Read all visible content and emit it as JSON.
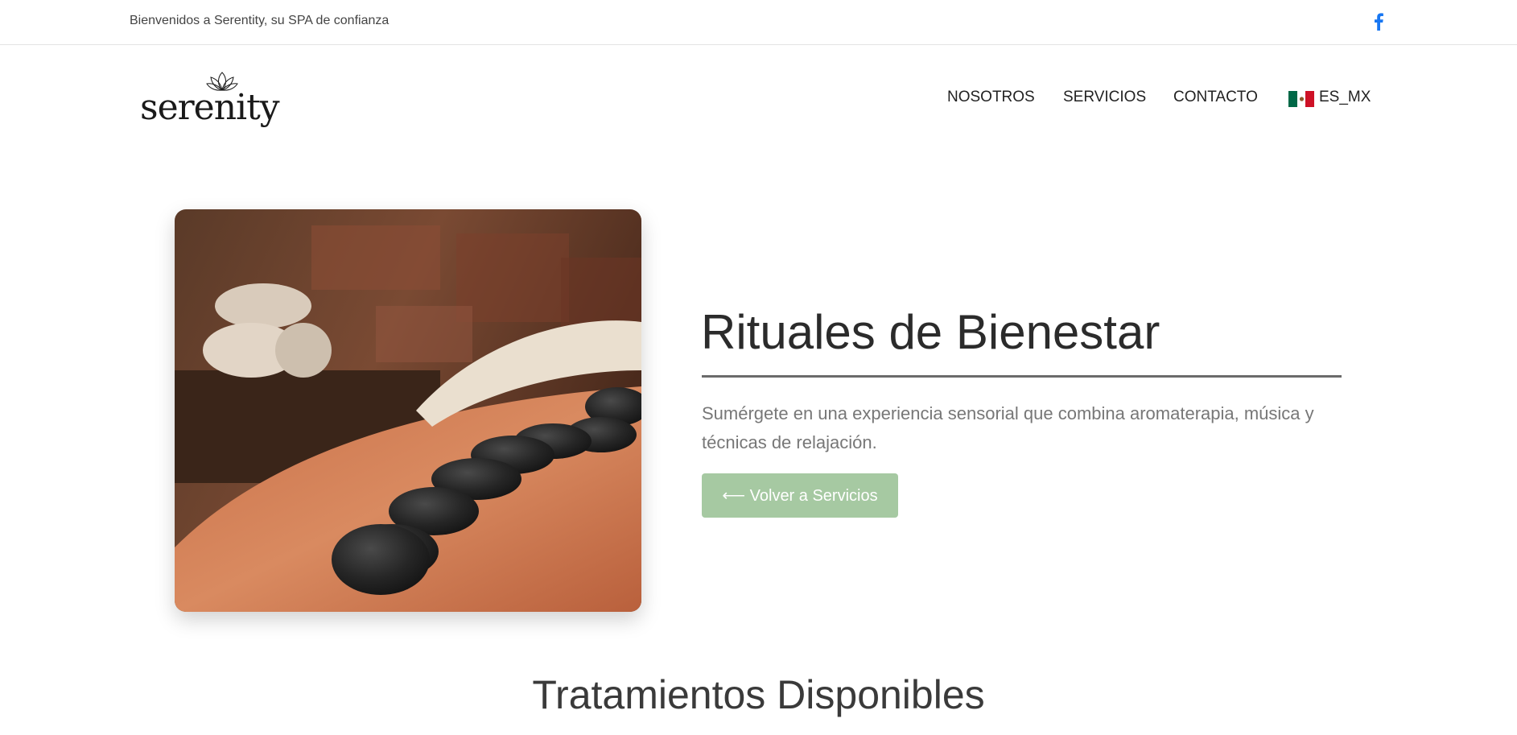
{
  "topbar": {
    "welcome_text": "Bienvenidos a Serentity, su SPA de confianza",
    "facebook_icon": "facebook-icon",
    "facebook_color": "#1877f2"
  },
  "header": {
    "logo_text": "serenity",
    "nav": [
      {
        "label": "NOSOTROS"
      },
      {
        "label": "SERVICIOS"
      },
      {
        "label": "CONTACTO"
      }
    ],
    "language": {
      "label": "ES_MX",
      "flag_icon": "mexico-flag-icon"
    }
  },
  "hero": {
    "image_icon": "hot-stone-massage-photo",
    "title": "Rituales de Bienestar",
    "description": "Sumérgete en una experiencia sensorial que combina aromaterapia, música y técnicas de relajación.",
    "button_label": "⟵ Volver a Servicios",
    "button_color": "#a6c9a2"
  },
  "section": {
    "title": "Tratamientos Disponibles"
  }
}
